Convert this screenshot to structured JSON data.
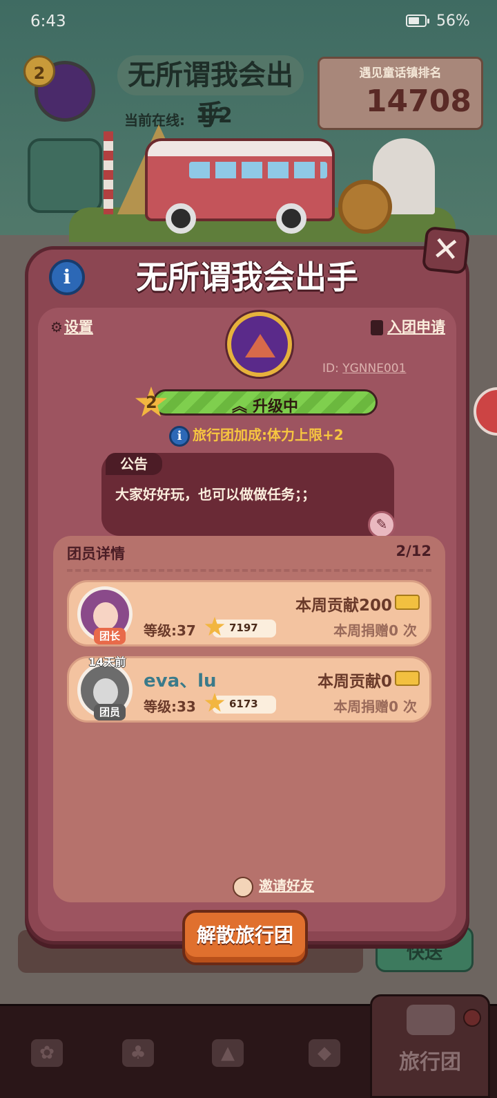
{
  "status_bar": {
    "time": "6:43",
    "battery": "56%"
  },
  "header": {
    "level": "2",
    "team_name": "无所谓我会出手",
    "online_label": "当前在线:",
    "online_value": "1/2",
    "rank_title": "遇见童话镇排名",
    "rank_value": "14708"
  },
  "modal": {
    "title": "无所谓我会出手",
    "settings_label": "设置",
    "apply_label": "入团申请",
    "id_label": "ID: ",
    "id_value": "YGNNE001",
    "level": "2",
    "level_status": "升级中",
    "bonus_text": "旅行团加成:体力上限+2",
    "notice_title": "公告",
    "notice_text": "大家好好玩，也可以做做任务；；",
    "members_title": "团员详情",
    "members_count": "2/12",
    "members": [
      {
        "name": "",
        "role": "团长",
        "last_seen": "",
        "level": "等级:37",
        "stars": "7197",
        "contribution": "本周贡献200",
        "donations": "本周捐赠0 次"
      },
      {
        "name": "eva、lu",
        "role": "团员",
        "last_seen": "14天前",
        "level": "等级:33",
        "stars": "6173",
        "contribution": "本周贡献0",
        "donations": "本周捐赠0 次"
      }
    ],
    "invite_label": "邀请好友",
    "disband_label": "解散旅行团"
  },
  "behind": {
    "right_button": "快送"
  },
  "bottom_nav": {
    "items": [
      {
        "icon": "bag-icon"
      },
      {
        "icon": "cards-icon"
      },
      {
        "icon": "bell-icon"
      },
      {
        "icon": "map-icon"
      }
    ],
    "active_label": "旅行团"
  },
  "colors": {
    "modal_bg": "#8c4652",
    "progress_green": "#7fcf4e",
    "disband_orange": "#e0702e",
    "member_name_teal": "#3a7a8a"
  }
}
